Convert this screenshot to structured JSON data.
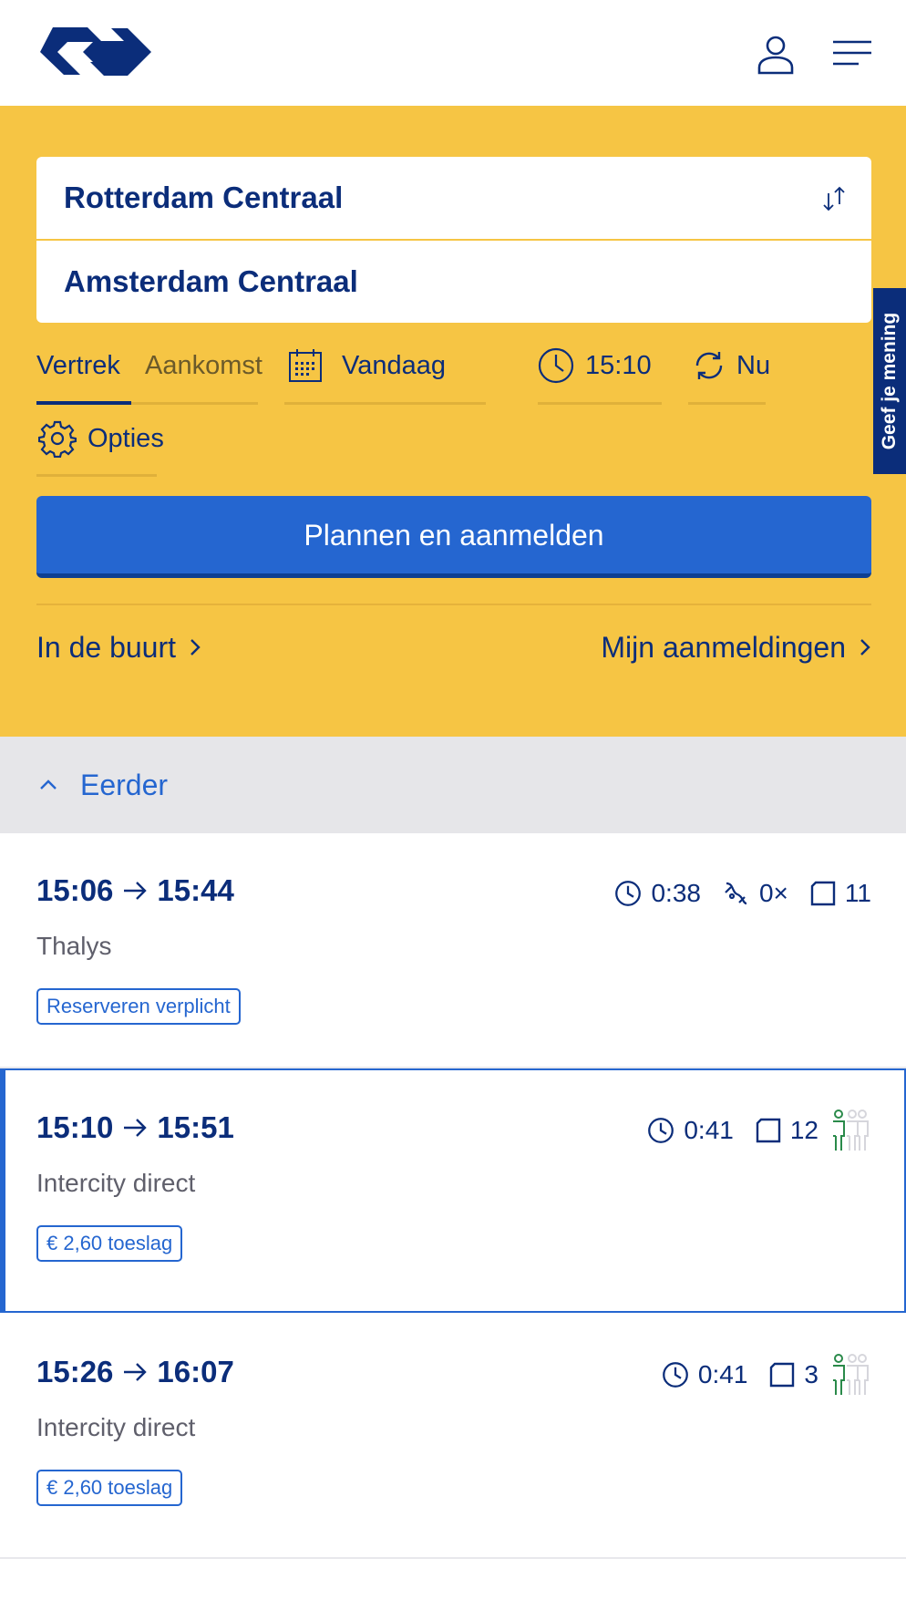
{
  "header": {
    "logo_icon": "ns-logo-icon",
    "user_icon": "user-icon",
    "menu_icon": "hamburger-menu-icon"
  },
  "planner": {
    "from": "Rotterdam Centraal",
    "to": "Amsterdam Centraal",
    "swap_icon": "swap-icon",
    "tabs": [
      {
        "label": "Vertrek",
        "active": true
      },
      {
        "label": "Aankomst",
        "active": false
      }
    ],
    "date_label": "Vandaag",
    "time_label": "15:10",
    "now_label": "Nu",
    "options_label": "Opties",
    "plan_button": "Plannen en aanmelden",
    "nearby_link": "In de buurt",
    "my_checkins_link": "Mijn aanmeldingen"
  },
  "feedback": {
    "label": "Geef je mening"
  },
  "earlier": {
    "label": "Eerder"
  },
  "trips": [
    {
      "departure": "15:06",
      "arrival": "15:44",
      "duration": "0:38",
      "transfers": "0×",
      "platform": "11",
      "type": "Thalys",
      "badge": "Reserveren verplicht",
      "crowding": null,
      "selected": false
    },
    {
      "departure": "15:10",
      "arrival": "15:51",
      "duration": "0:41",
      "transfers": null,
      "platform": "12",
      "type": "Intercity direct",
      "badge": "€ 2,60 toeslag",
      "crowding": "low",
      "selected": true
    },
    {
      "departure": "15:26",
      "arrival": "16:07",
      "duration": "0:41",
      "transfers": null,
      "platform": "3",
      "type": "Intercity direct",
      "badge": "€ 2,60 toeslag",
      "crowding": "low",
      "selected": false
    }
  ],
  "colors": {
    "yellow": "#f6c544",
    "ns_blue": "#0b2d7a",
    "action_blue": "#2566d0",
    "crowd_green": "#2a8a4a"
  }
}
